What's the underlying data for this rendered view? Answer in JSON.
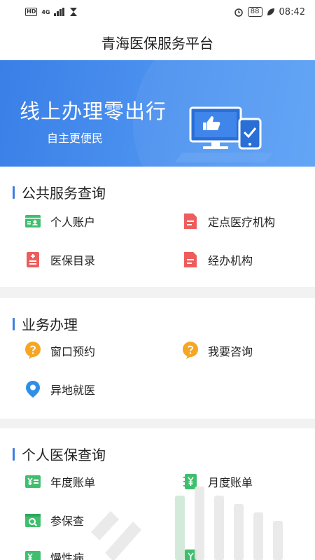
{
  "status_bar": {
    "network_hd": "HD",
    "network_4g": "4G",
    "battery": "88",
    "time": "08:42"
  },
  "app": {
    "title": "青海医保服务平台"
  },
  "banner": {
    "title": "线上办理零出行",
    "subtitle": "自主更便民"
  },
  "sections": {
    "public": {
      "heading": "公共服务查询",
      "items": [
        {
          "label": "个人账户",
          "icon": "account-card-icon"
        },
        {
          "label": "定点医疗机构",
          "icon": "document-icon"
        },
        {
          "label": "医保目录",
          "icon": "catalog-icon"
        },
        {
          "label": "经办机构",
          "icon": "document-icon"
        }
      ]
    },
    "business": {
      "heading": "业务办理",
      "items": [
        {
          "label": "窗口预约",
          "icon": "question-bubble-icon"
        },
        {
          "label": "我要咨询",
          "icon": "question-bubble-icon"
        },
        {
          "label": "异地就医",
          "icon": "location-pin-icon"
        }
      ]
    },
    "personal": {
      "heading": "个人医保查询",
      "items": [
        {
          "label": "年度账单",
          "icon": "yen-card-icon"
        },
        {
          "label": "月度账单",
          "icon": "yen-notebook-icon"
        },
        {
          "label": "参保查",
          "icon": "search-doc-icon"
        },
        {
          "label": "慢性病",
          "icon": "yen-card-icon"
        },
        {
          "label": "",
          "icon": "yen-notebook-icon"
        }
      ]
    }
  },
  "colors": {
    "accent": "#3d7fe0",
    "icon_red": "#ee5d5d",
    "icon_green": "#3fbf6e",
    "icon_orange": "#f5a623",
    "icon_blue": "#2f8fe6"
  }
}
